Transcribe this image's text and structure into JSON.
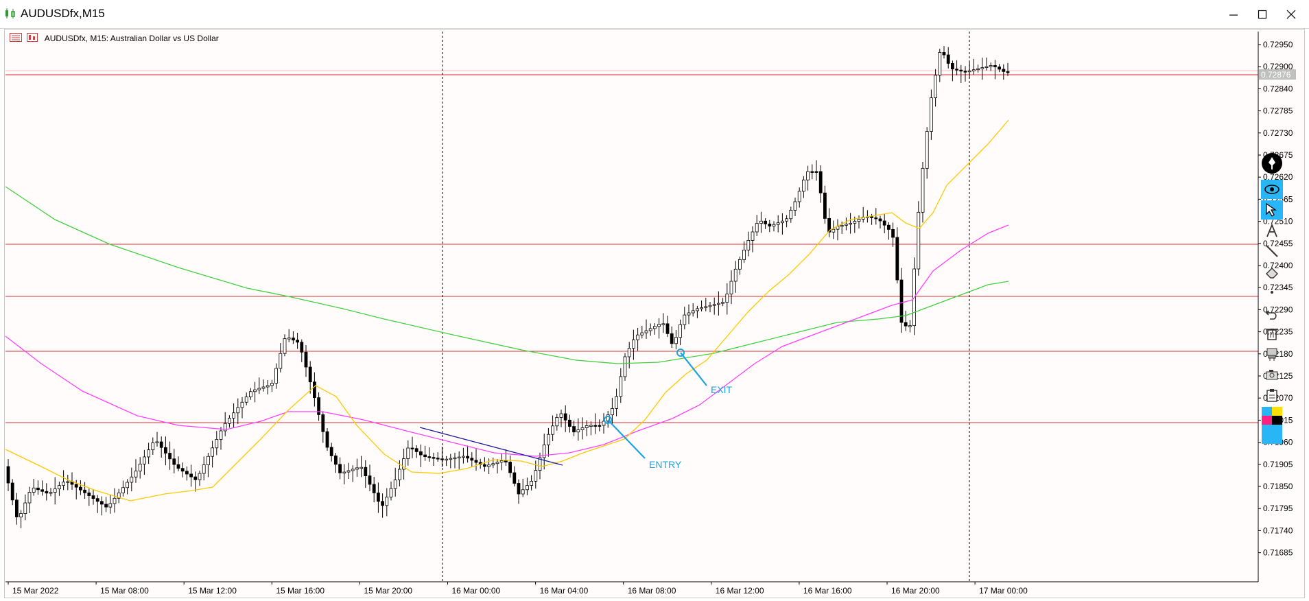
{
  "window": {
    "title": "AUDUSDfx,M15",
    "minimize_icon": "minimize-icon",
    "maximize_icon": "maximize-icon",
    "close_icon": "close-icon"
  },
  "chart_header": {
    "symbol_info": "AUDUSDfx, M15:  Australian Dollar vs US Dollar"
  },
  "price_axis": {
    "ticks": [
      "0.72950",
      "0.72900",
      "0.72840",
      "0.72785",
      "0.72730",
      "0.72675",
      "0.72620",
      "0.72565",
      "0.72510",
      "0.72455",
      "0.72400",
      "0.72345",
      "0.72290",
      "0.72235",
      "0.72180",
      "0.72125",
      "0.72070",
      "0.72015",
      "0.71960",
      "0.71905",
      "0.71850",
      "0.71795",
      "0.71740",
      "0.71685"
    ],
    "current_price": "0.72876",
    "current_price_color": "#c0c0c0"
  },
  "time_axis": {
    "ticks": [
      "15 Mar 2022",
      "15 Mar 08:00",
      "15 Mar 12:00",
      "15 Mar 16:00",
      "15 Mar 20:00",
      "16 Mar 00:00",
      "16 Mar 04:00",
      "16 Mar 08:00",
      "16 Mar 12:00",
      "16 Mar 16:00",
      "16 Mar 20:00",
      "17 Mar 00:00"
    ]
  },
  "annotations": {
    "entry_label": "ENTRY",
    "exit_label": "EXIT",
    "color": "#1aa3e0"
  },
  "colors": {
    "horizontal_lines": "#e03030",
    "ma_fast": "#ffc800",
    "ma_mid": "#ff40ff",
    "ma_slow": "#40d040",
    "trendline": "#1a1aa0",
    "background": "#fffcfb"
  },
  "toolbar": {
    "items": [
      "pen-icon",
      "eye-icon",
      "cursor-icon",
      "text-icon",
      "line-icon",
      "eraser-icon",
      "dot-icon",
      "undo-icon",
      "trash-icon",
      "stamp-icon",
      "camera-icon",
      "clipboard-icon",
      "color-palette-icon"
    ]
  }
}
